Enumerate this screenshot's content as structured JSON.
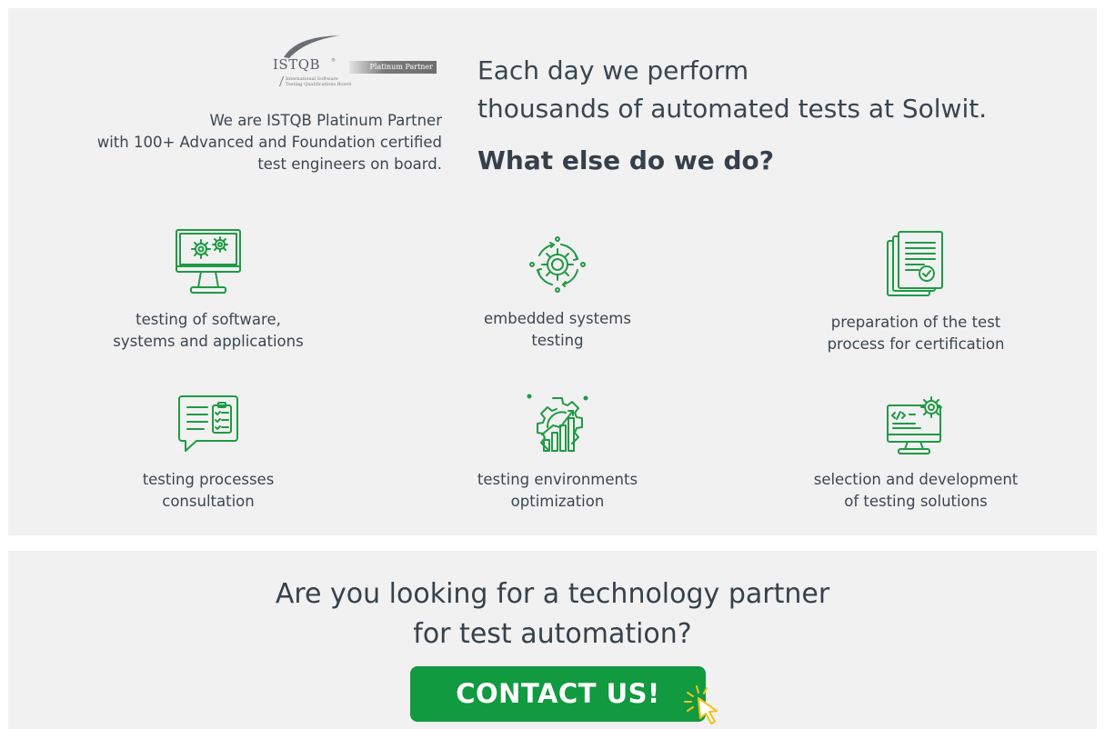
{
  "logo": {
    "wordmark": "ISTQB",
    "badge": "Platinum Partner",
    "board_lines": [
      "International Software",
      "Testing Qualifications Board"
    ]
  },
  "intro": {
    "partner_line1": "We are ISTQB Platinum Partner",
    "partner_line2": "with 100+ Advanced and Foundation certified",
    "partner_line3": "test engineers on board.",
    "headline_line1": "Each day we perform",
    "headline_line2": "thousands of automated tests at Solwit.",
    "subheadline": "What else do we do?"
  },
  "services": [
    {
      "icon": "monitor-gears-icon",
      "line1": "testing of software,",
      "line2": "systems and applications"
    },
    {
      "icon": "cycle-gear-icon",
      "line1": "embedded systems",
      "line2": "testing"
    },
    {
      "icon": "certified-documents-icon",
      "line1": "preparation of the test",
      "line2": "process for certification"
    },
    {
      "icon": "consultation-checklist-icon",
      "line1": "testing processes",
      "line2": "consultation"
    },
    {
      "icon": "gear-growth-chart-icon",
      "line1": "testing environments",
      "line2": "optimization"
    },
    {
      "icon": "code-monitor-gear-icon",
      "line1": "selection and development",
      "line2": "of testing solutions"
    }
  ],
  "cta": {
    "title_line1": "Are you looking for a technology partner",
    "title_line2": "for test automation?",
    "button_label": "CONTACT US!"
  },
  "colors": {
    "panel_bg": "#f1f1f1",
    "icon_green": "#1f9a45",
    "button_green": "#119a3f",
    "text": "#36424e",
    "cursor_yellow": "#f2c21b"
  }
}
